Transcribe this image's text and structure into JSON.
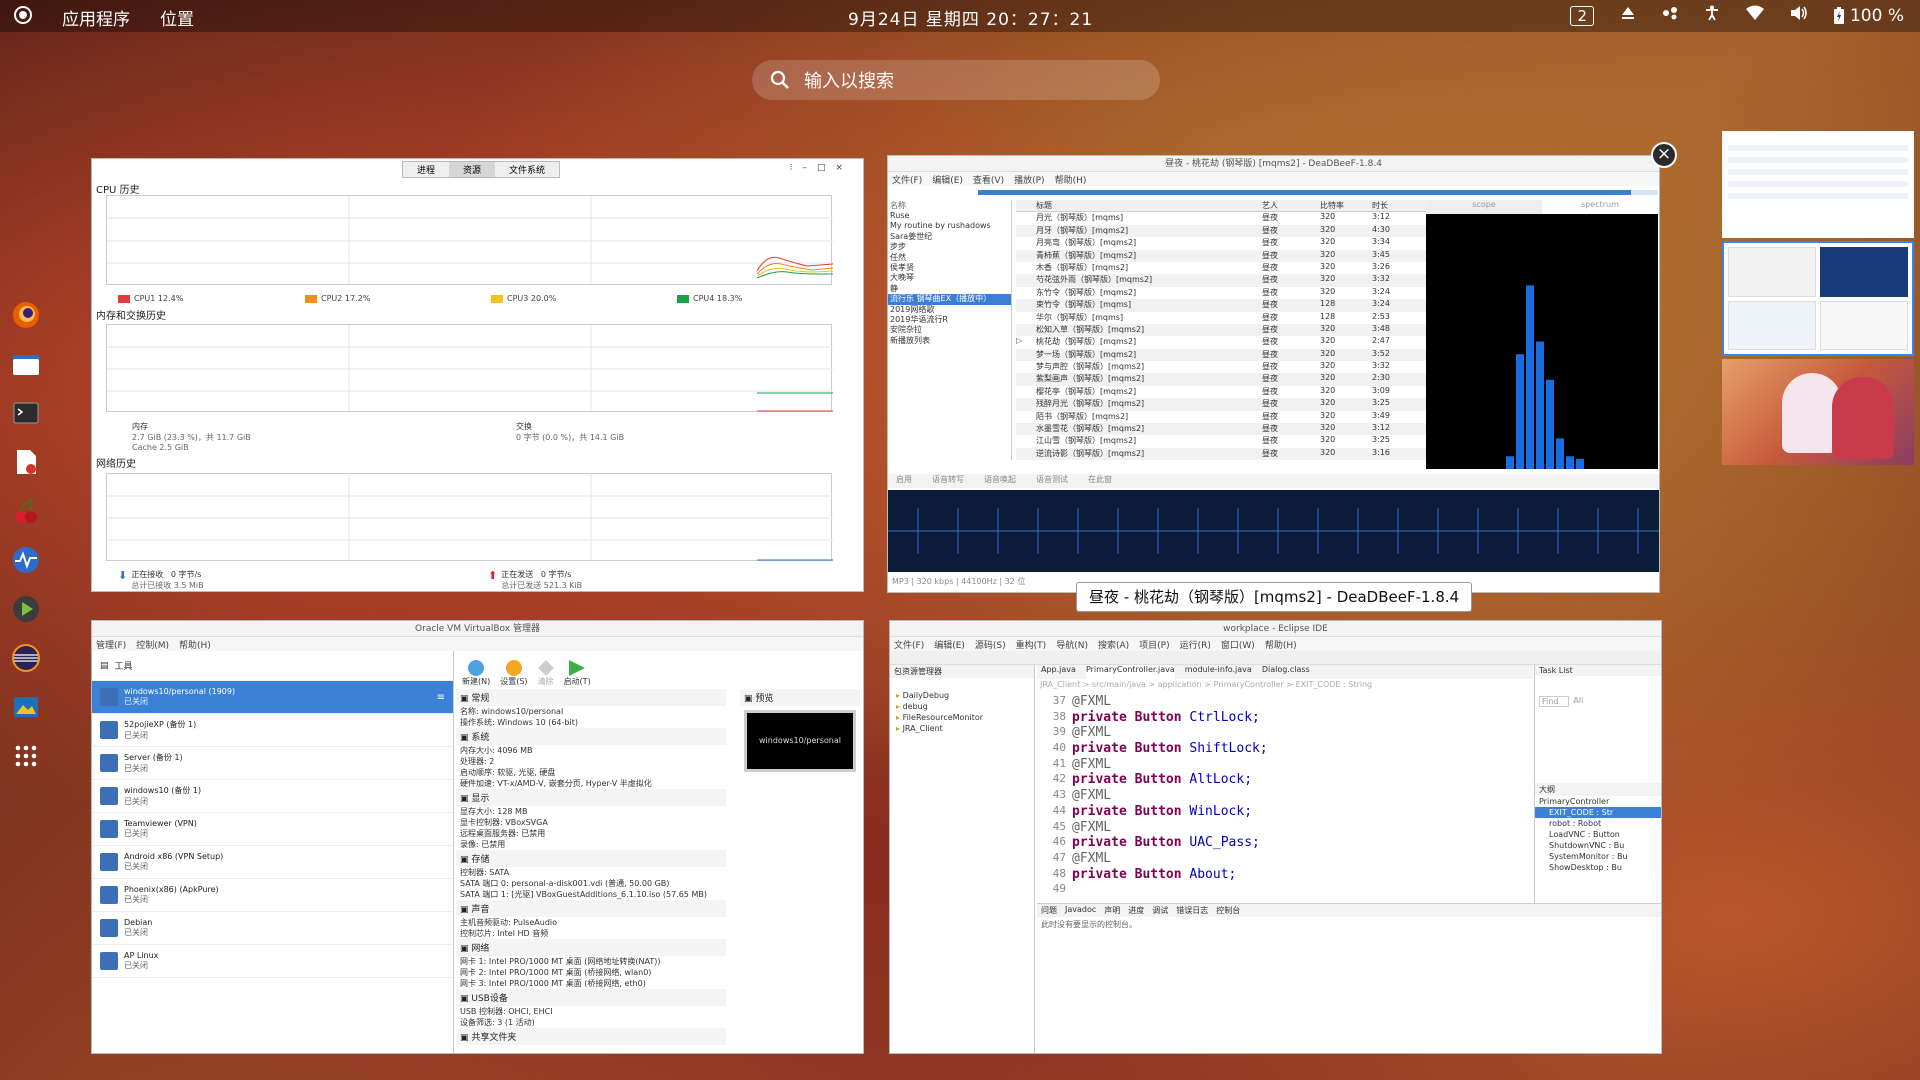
{
  "topbar": {
    "apps_label": "应用程序",
    "places_label": "位置",
    "clock": "9月24日 星期四 20：27：21",
    "workspace_count": "2",
    "battery": "100 %"
  },
  "search": {
    "placeholder": "输入以搜索"
  },
  "sysmon": {
    "tabs": [
      "进程",
      "资源",
      "文件系统"
    ],
    "cpu_title": "CPU 历史",
    "cpu": [
      "CPU1 12.4%",
      "CPU2 17.2%",
      "CPU3 20.0%",
      "CPU4 18.3%"
    ],
    "cpu_colors": [
      "#e33b3b",
      "#f08a1f",
      "#f4c21f",
      "#1aa34a"
    ],
    "mem_title": "内存和交换历史",
    "mem_label": "内存",
    "mem_value": "2.7 GiB (23.3 %)，共 11.7 GiB",
    "mem_cache": "Cache 2.5 GiB",
    "swap_label": "交换",
    "swap_value": "0 字节 (0.0 %)，共 14.1 GiB",
    "net_title": "网络历史",
    "recv_label": "正在接收",
    "recv_value": "0 字节/s",
    "recv_total": "总计已接收 3.5 MiB",
    "send_label": "正在发送",
    "send_value": "0 字节/s",
    "send_total": "总计已发送 521.3 KiB"
  },
  "deadbeef": {
    "title": "昼夜 - 桃花劫 (钢琴版) [mqms2] - DeaDBeeF-1.8.4",
    "menu": [
      "文件(F)",
      "编辑(E)",
      "查看(V)",
      "播放(P)",
      "帮助(H)"
    ],
    "sidebar_header": "名称",
    "playlists": [
      "Ruse",
      "My routine by rushadows",
      "Sara姜世纪",
      "步步",
      "任然",
      "侯孝贤",
      "大晚琴",
      "静",
      "流行乐 钢琴曲EX（播放中）",
      "2019网络歌",
      "2019华语流行R",
      "安院杂拉",
      "新播放列表"
    ],
    "columns": [
      "标题",
      "艺人",
      "比特率",
      "时长"
    ],
    "tracks": [
      [
        "月光（钢琴版）[mqms]",
        "昼夜",
        "320",
        "3:12"
      ],
      [
        "月牙（钢琴版）[mqms2]",
        "昼夜",
        "320",
        "4:30"
      ],
      [
        "月亮弯（钢琴版）[mqms2]",
        "昼夜",
        "320",
        "3:34"
      ],
      [
        "青柿蕉（钢琴版）[mqms2]",
        "昼夜",
        "320",
        "3:45"
      ],
      [
        "木香（钢琴版）[mqms2]",
        "昼夜",
        "320",
        "3:26"
      ],
      [
        "芍花弦外雨（钢琴版）[mqms2]",
        "昼夜",
        "320",
        "3:32"
      ],
      [
        "东竹令（钢琴版）[mqms2]",
        "昼夜",
        "320",
        "3:24"
      ],
      [
        "束竹令（钢琴版）[mqms]",
        "昼夜",
        "128",
        "3:24"
      ],
      [
        "华尔（钢琴版）[mqms]",
        "昼夜",
        "128",
        "2:53"
      ],
      [
        "松知入草（钢琴版）[mqms2]",
        "昼夜",
        "320",
        "3:48"
      ],
      [
        "桃花劫（钢琴版）[mqms2]",
        "昼夜",
        "320",
        "2:47"
      ],
      [
        "梦一场（钢琴版）[mqms2]",
        "昼夜",
        "320",
        "3:52"
      ],
      [
        "梦与声腔（钢琴版）[mqms2]",
        "昼夜",
        "320",
        "3:32"
      ],
      [
        "紫梨画声（钢琴版）[mqms2]",
        "昼夜",
        "320",
        "2:30"
      ],
      [
        "樱花亭（钢琴版）[mqms2]",
        "昼夜",
        "320",
        "3:09"
      ],
      [
        "残醉月光（钢琴版）[mqms2]",
        "昼夜",
        "320",
        "3:25"
      ],
      [
        "陌书（钢琴版）[mqms2]",
        "昼夜",
        "320",
        "3:49"
      ],
      [
        "水墨雪花（钢琴版）[mqms2]",
        "昼夜",
        "320",
        "3:12"
      ],
      [
        "江山雪（钢琴版）[mqms2]",
        "昼夜",
        "320",
        "3:25"
      ],
      [
        "逆流诗影（钢琴版）[mqms2]",
        "昼夜",
        "320",
        "3:16"
      ]
    ],
    "vis_tabs": [
      "scope",
      "spectrum"
    ],
    "bottom_tabs": [
      "启用",
      "语音转写",
      "语音唤起",
      "语音测试",
      "在此窗"
    ],
    "status": "MP3 | 320 kbps | 44100Hz | 32 位",
    "spectrum_bars": [
      0.05,
      0.45,
      0.72,
      0.5,
      0.35,
      0.12,
      0.05,
      0.04
    ]
  },
  "tooltip": "昼夜 - 桃花劫（钢琴版）[mqms2] - DeaDBeeF-1.8.4",
  "vbox": {
    "title": "Oracle VM VirtualBox 管理器",
    "menu": [
      "管理(F)",
      "控制(M)",
      "帮助(H)"
    ],
    "tools_label": "工具",
    "toolbar": [
      "新建(N)",
      "设置(S)",
      "清除",
      "启动(T)"
    ],
    "vms": [
      [
        "windows10/personal (1909)",
        "已关闭"
      ],
      [
        "52pojieXP (备份 1)",
        "已关闭"
      ],
      [
        "Server (备份 1)",
        "已关闭"
      ],
      [
        "windows10 (备份 1)",
        "已关闭"
      ],
      [
        "Teamviewer (VPN)",
        "已关闭"
      ],
      [
        "Android x86 (VPN Setup)",
        "已关闭"
      ],
      [
        "Phoenix(x86) (ApkPure)",
        "已关闭"
      ],
      [
        "Debian",
        "已关闭"
      ],
      [
        "AP Linux",
        "已关闭"
      ]
    ],
    "general_h": "常规",
    "general": [
      "名称:        windows10/personal",
      "操作系统: Windows 10 (64-bit)"
    ],
    "system_h": "系统",
    "system": [
      "内存大小: 4096 MB",
      "处理器:    2",
      "启动顺序: 软驱, 光驱, 硬盘",
      "硬件加速: VT-x/AMD-V, 嵌套分页, Hyper-V 半虚拟化"
    ],
    "display_h": "显示",
    "display": [
      "显存大小:          128 MB",
      "显卡控制器:        VBoxSVGA",
      "远程桌面服务器: 已禁用",
      "录像:                  已禁用"
    ],
    "storage_h": "存储",
    "storage": [
      "控制器: SATA",
      "  SATA 端口 0: personal-a-disk001.vdi (普通, 50.00 GB)",
      "  SATA 端口 1: [光驱] VBoxGuestAdditions_6.1.10.iso (57.65 MB)"
    ],
    "audio_h": "声音",
    "audio": [
      "主机音频驱动: PulseAudio",
      "控制芯片:       Intel HD 音频"
    ],
    "network_h": "网络",
    "network": [
      "网卡 1: Intel PRO/1000 MT 桌面 (网络地址转换(NAT))",
      "网卡 2: Intel PRO/1000 MT 桌面 (桥接网络, wlan0)",
      "网卡 3: Intel PRO/1000 MT 桌面 (桥接网络, eth0)"
    ],
    "usb_h": "USB设备",
    "usb": [
      "USB 控制器: OHCI, EHCI",
      "设备筛选:    3 (1 活动)"
    ],
    "shared_h": "共享文件夹",
    "preview_h": "预览",
    "preview_name": "windows10/personal"
  },
  "eclipse": {
    "title": "workplace - Eclipse IDE",
    "menu": [
      "文件(F)",
      "编辑(E)",
      "源码(S)",
      "重构(T)",
      "导航(N)",
      "搜索(A)",
      "项目(P)",
      "运行(R)",
      "窗口(W)",
      "帮助(H)"
    ],
    "pkg_title": "包资源管理器",
    "tree": [
      "DailyDebug",
      "debug",
      "FileResourceMonitor",
      "JRA_Client"
    ],
    "tabs": [
      "App.java",
      "PrimaryController.java",
      "module-info.java",
      "Dialog.class"
    ],
    "breadcrumb": "JRA_Client > src/main/java > application > PrimaryController > EXIT_CODE : String",
    "code": [
      [
        "37",
        "@FXML",
        ""
      ],
      [
        "38",
        "private Button ",
        "CtrlLock;"
      ],
      [
        "39",
        "@FXML",
        ""
      ],
      [
        "40",
        "private Button ",
        "ShiftLock;"
      ],
      [
        "41",
        "@FXML",
        ""
      ],
      [
        "42",
        "private Button ",
        "AltLock;"
      ],
      [
        "43",
        "@FXML",
        ""
      ],
      [
        "44",
        "private Button ",
        "WinLock;"
      ],
      [
        "45",
        "@FXML",
        ""
      ],
      [
        "46",
        "private Button ",
        "UAC_Pass;"
      ],
      [
        "47",
        "@FXML",
        ""
      ],
      [
        "48",
        "private Button ",
        "About;"
      ],
      [
        "49",
        "",
        ""
      ]
    ],
    "task_title": "Task List",
    "find_placeholder": "Find",
    "all_label": "All",
    "outline_title": "大纲",
    "outline": [
      "PrimaryController",
      "EXIT_CODE : Str",
      "robot : Robot",
      "LoadVNC : Button",
      "ShutdownVNC : Bu",
      "SystemMonitor : Bu",
      "ShowDesktop : Bu"
    ],
    "bottom_tabs": [
      "问题",
      "Javadoc",
      "声明",
      "进度",
      "调试",
      "错误日志",
      "控制台"
    ],
    "console_msg": "此时没有要显示的控制台。"
  }
}
